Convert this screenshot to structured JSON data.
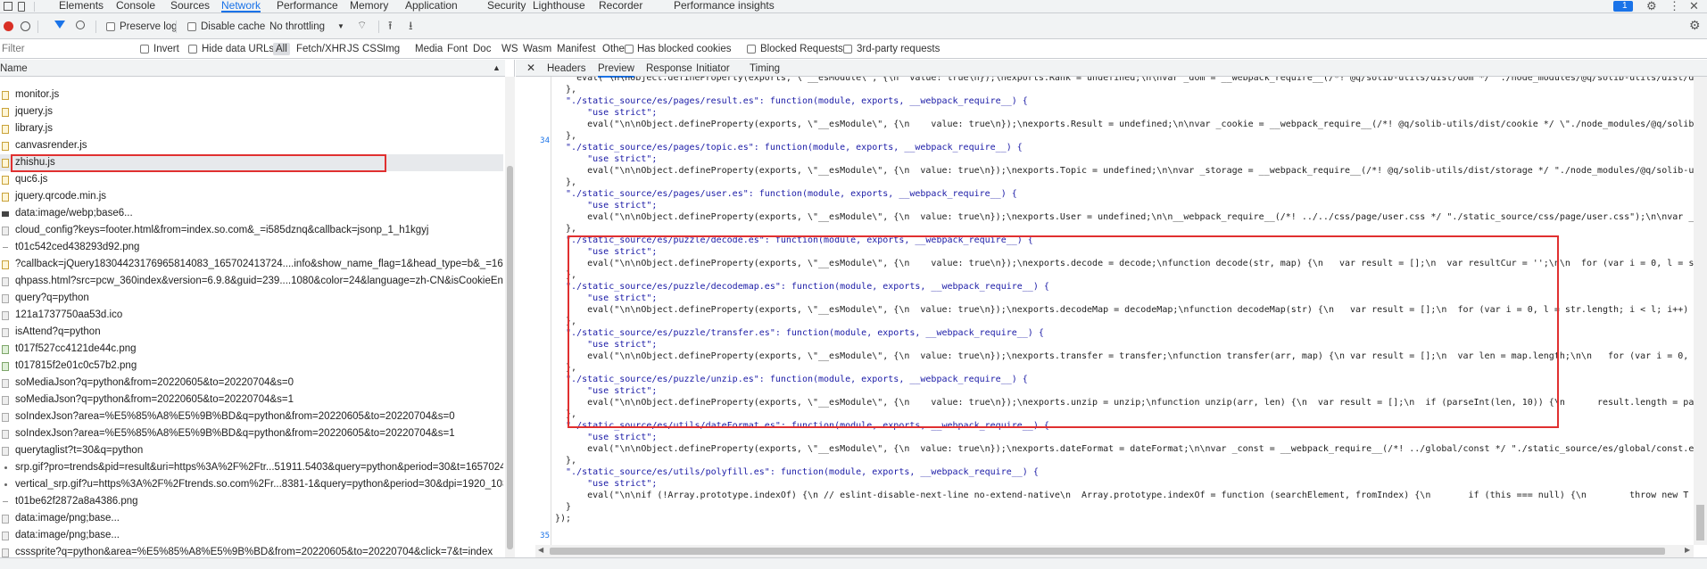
{
  "devtools": {
    "tabs": [
      "Elements",
      "Console",
      "Sources",
      "Network",
      "Performance",
      "Memory",
      "Application",
      "Security",
      "Lighthouse",
      "Recorder",
      "Performance insights"
    ],
    "active_tab": "Network",
    "issues_count": "1",
    "accent": "#1a73e8"
  },
  "toolbar": {
    "preserve_log": "Preserve log",
    "disable_cache": "Disable cache",
    "throttling": "No throttling"
  },
  "filter": {
    "placeholder": "Filter",
    "invert": "Invert",
    "hide_data_urls": "Hide data URLs",
    "types": [
      "All",
      "Fetch/XHR",
      "JS",
      "CSS",
      "Img",
      "Media",
      "Font",
      "Doc",
      "WS",
      "Wasm",
      "Manifest",
      "Other"
    ],
    "has_blocked_cookies": "Has blocked cookies",
    "blocked_requests": "Blocked Requests",
    "third_party": "3rd-party requests"
  },
  "request_list": {
    "header": "Name",
    "rows": [
      {
        "name": "monitor.js",
        "icon": "js"
      },
      {
        "name": "jquery.js",
        "icon": "js"
      },
      {
        "name": "library.js",
        "icon": "js"
      },
      {
        "name": "canvasrender.js",
        "icon": "js"
      },
      {
        "name": "zhishu.js",
        "icon": "js",
        "selected": true
      },
      {
        "name": "quc6.js",
        "icon": "js"
      },
      {
        "name": "jquery.qrcode.min.js",
        "icon": "js"
      },
      {
        "name": "data:image/webp;base6...",
        "icon": "dark"
      },
      {
        "name": "cloud_config?keys=footer.html&from=index.so.com&_=i585dznq&callback=jsonp_1_h1kgyj",
        "icon": "doc"
      },
      {
        "name": "t01c542ced438293d92.png",
        "icon": "dash"
      },
      {
        "name": "?callback=jQuery18304423176965814083_165702413724....info&show_name_flag=1&head_type=b&_=16570241372...",
        "icon": "js"
      },
      {
        "name": "qhpass.html?src=pcw_360index&version=6.9.8&guid=239....1080&color=24&language=zh-CN&isCookieEnabled=tru...",
        "icon": "doc"
      },
      {
        "name": "query?q=python",
        "icon": "doc"
      },
      {
        "name": "121a1737750aa53d.ico",
        "icon": "doc"
      },
      {
        "name": "isAttend?q=python",
        "icon": "doc"
      },
      {
        "name": "t017f527cc4121de44c.png",
        "icon": "img"
      },
      {
        "name": "t017815f2e01c0c57b2.png",
        "icon": "img"
      },
      {
        "name": "soMediaJson?q=python&from=20220605&to=20220704&s=0",
        "icon": "doc"
      },
      {
        "name": "soMediaJson?q=python&from=20220605&to=20220704&s=1",
        "icon": "doc"
      },
      {
        "name": "soIndexJson?area=%E5%85%A8%E5%9B%BD&q=python&from=20220605&to=20220704&s=0",
        "icon": "doc"
      },
      {
        "name": "soIndexJson?area=%E5%85%A8%E5%9B%BD&q=python&from=20220605&to=20220704&s=1",
        "icon": "doc"
      },
      {
        "name": "querytaglist?t=30&q=python",
        "icon": "doc"
      },
      {
        "name": "srp.gif?pro=trends&pid=result&uri=https%3A%2F%2Ftr...51911.5403&query=python&period=30&t=1657024138...",
        "icon": "dot"
      },
      {
        "name": "vertical_srp.gif?u=https%3A%2F%2Ftrends.so.com%2Fr...8381-1&query=python&period=30&dpi=1920_1080&dpr...",
        "icon": "dot"
      },
      {
        "name": "t01be62f2872a8a4386.png",
        "icon": "dash"
      },
      {
        "name": "data:image/png;base...",
        "icon": "doc"
      },
      {
        "name": "data:image/png;base...",
        "icon": "doc"
      },
      {
        "name": "csssprite?q=python&area=%E5%85%A8%E5%9B%BD&from=20220605&to=20220704&click=7&t=index",
        "icon": "doc"
      }
    ]
  },
  "detail": {
    "tabs": [
      "Headers",
      "Preview",
      "Response",
      "Initiator",
      "Timing"
    ],
    "active_tab": "Preview",
    "line_numbers": [
      "34",
      "35"
    ],
    "code_lines": [
      "    eval(\"\\n\\nObject.defineProperty(exports, \\\"__esModule\\\", {\\n  value: true\\n});\\nexports.Rank = undefined;\\n\\nvar _dom = __webpack_require__(/*! @q/solib-utils/dist/dom */ \"./node_modules/@q/solib-utils/dist/do",
      "  },",
      "  \"./static_source/es/pages/result.es\": function(module, exports, __webpack_require__) {",
      "      \"use strict\";",
      "      eval(\"\\n\\nObject.defineProperty(exports, \\\"__esModule\\\", {\\n    value: true\\n});\\nexports.Result = undefined;\\n\\nvar _cookie = __webpack_require__(/*! @q/solib-utils/dist/cookie */ \\\"./node_modules/@q/solib-",
      "  },",
      "  \"./static_source/es/pages/topic.es\": function(module, exports, __webpack_require__) {",
      "      \"use strict\";",
      "      eval(\"\\n\\nObject.defineProperty(exports, \\\"__esModule\\\", {\\n  value: true\\n});\\nexports.Topic = undefined;\\n\\nvar _storage = __webpack_require__(/*! @q/solib-utils/dist/storage */ \"./node_modules/@q/solib-uti",
      "  },",
      "  \"./static_source/es/pages/user.es\": function(module, exports, __webpack_require__) {",
      "      \"use strict\";",
      "      eval(\"\\n\\nObject.defineProperty(exports, \\\"__esModule\\\", {\\n  value: true\\n});\\nexports.User = undefined;\\n\\n__webpack_require__(/*! ../../css/page/user.css */ \"./static_source/css/page/user.css\");\\n\\nvar _cor",
      "  },",
      "  \"./static_source/es/puzzle/decode.es\": function(module, exports, __webpack_require__) {",
      "      \"use strict\";",
      "      eval(\"\\n\\nObject.defineProperty(exports, \\\"__esModule\\\", {\\n    value: true\\n});\\nexports.decode = decode;\\nfunction decode(str, map) {\\n   var result = [];\\n  var resultCur = '';\\n\\n  for (var i = 0, l = str",
      "  },",
      "  \"./static_source/es/puzzle/decodemap.es\": function(module, exports, __webpack_require__) {",
      "      \"use strict\";",
      "      eval(\"\\n\\nObject.defineProperty(exports, \\\"__esModule\\\", {\\n  value: true\\n});\\nexports.decodeMap = decodeMap;\\nfunction decodeMap(str) {\\n   var result = [];\\n  for (var i = 0, l = str.length; i < l; i++) {\\",
      "  },",
      "  \"./static_source/es/puzzle/transfer.es\": function(module, exports, __webpack_require__) {",
      "      \"use strict\";",
      "      eval(\"\\n\\nObject.defineProperty(exports, \\\"__esModule\\\", {\\n  value: true\\n});\\nexports.transfer = transfer;\\nfunction transfer(arr, map) {\\n var result = [];\\n  var len = map.length;\\n\\n   for (var i = 0, l =",
      "  },",
      "  \"./static_source/es/puzzle/unzip.es\": function(module, exports, __webpack_require__) {",
      "      \"use strict\";",
      "      eval(\"\\n\\nObject.defineProperty(exports, \\\"__esModule\\\", {\\n    value: true\\n});\\nexports.unzip = unzip;\\nfunction unzip(arr, len) {\\n  var result = [];\\n  if (parseInt(len, 10)) {\\n      result.length = par",
      "  },",
      "  \"./static_source/es/utils/dateFormat.es\": function(module, exports, __webpack_require__) {",
      "      \"use strict\";",
      "      eval(\"\\n\\nObject.defineProperty(exports, \\\"__esModule\\\", {\\n  value: true\\n});\\nexports.dateFormat = dateFormat;\\n\\nvar _const = __webpack_require__(/*! ../global/const */ \"./static_source/es/global/const.es\")",
      "  },",
      "  \"./static_source/es/utils/polyfill.es\": function(module, exports, __webpack_require__) {",
      "      \"use strict\";",
      "      eval(\"\\n\\nif (!Array.prototype.indexOf) {\\n // eslint-disable-next-line no-extend-native\\n  Array.prototype.indexOf = function (searchElement, fromIndex) {\\n       if (this === null) {\\n        throw new T",
      "  }",
      "});"
    ]
  }
}
